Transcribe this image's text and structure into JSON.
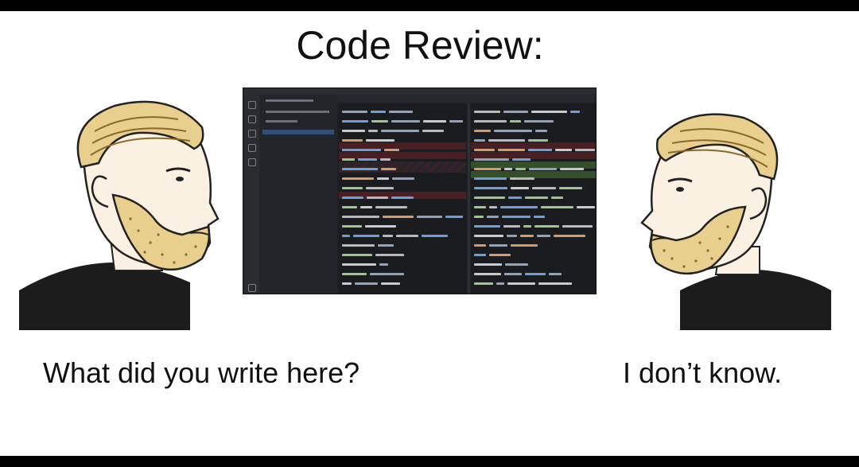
{
  "title": "Code Review:",
  "left_caption": "What did you write here?",
  "right_caption": "I don’t know.",
  "colors": {
    "background": "#ffffff",
    "frame": "#000000",
    "beard": "#e8cf8e",
    "shirt": "#1c1c1c",
    "editor_bg": "#1e1f22",
    "diff_removed": "#4a1f24",
    "diff_added": "#34502a"
  },
  "figures": {
    "left": "bearded-man-facing-right",
    "right": "bearded-man-facing-left"
  },
  "editor": {
    "type": "code-editor-diff-view"
  }
}
